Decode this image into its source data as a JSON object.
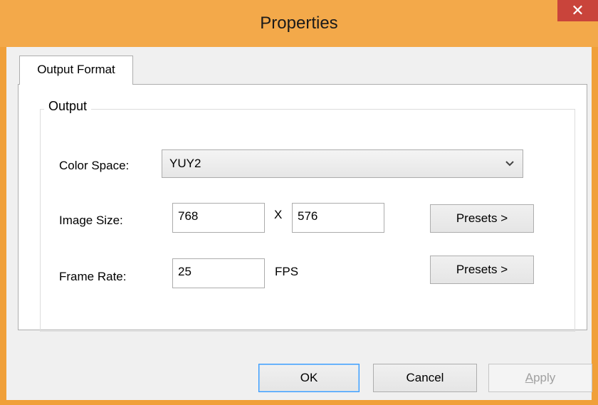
{
  "window": {
    "title": "Properties",
    "close_symbol": "✕"
  },
  "tabs": [
    {
      "label": "Output Format",
      "selected": true
    }
  ],
  "group": {
    "label": "Output"
  },
  "fields": {
    "color_space": {
      "label": "Color Space:",
      "value": "YUY2",
      "icon": "chevron-down-icon"
    },
    "image_size": {
      "label": "Image Size:",
      "width": "768",
      "separator": "X",
      "height": "576",
      "presets_label": "Presets >"
    },
    "frame_rate": {
      "label": "Frame Rate:",
      "value": "25",
      "unit": "FPS",
      "presets_label": "Presets >"
    }
  },
  "buttons": {
    "ok": "OK",
    "cancel": "Cancel",
    "apply_first": "A",
    "apply_rest": "pply"
  },
  "colors": {
    "titlebar": "#f3a94a",
    "close_button": "#c9443b",
    "focus_border": "#3399ff"
  }
}
